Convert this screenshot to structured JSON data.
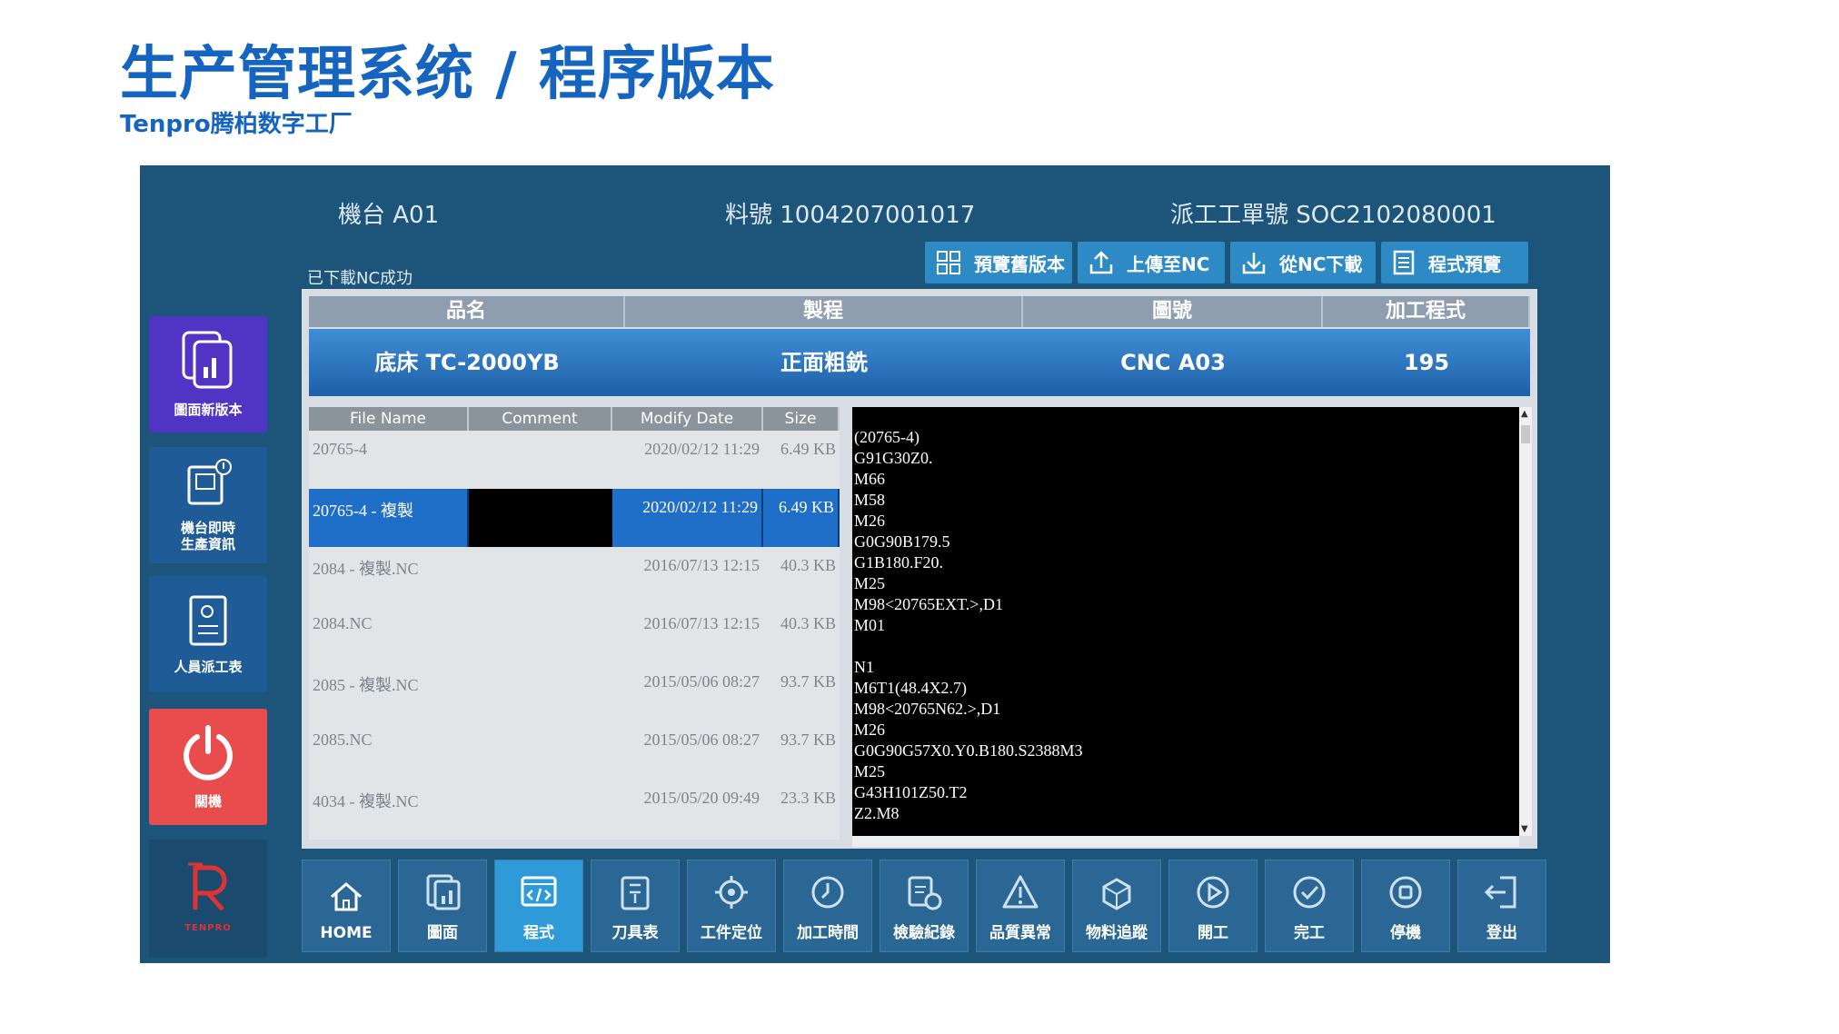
{
  "page": {
    "title": "生产管理系统 / 程序版本",
    "subtitle": "Tenpro腾柏数字工厂"
  },
  "header": {
    "machine": "機台 A01",
    "part_no": "料號 1004207001017",
    "work_order": "派工工單號 SOC2102080001"
  },
  "status": "已下載NC成功",
  "toolbar": {
    "preview_old": "預覽舊版本",
    "upload": "上傳至NC",
    "download": "從NC下載",
    "program_preview": "程式預覽"
  },
  "sidebar": {
    "new_version": "圖面新版本",
    "machine_info_line1": "機台即時",
    "machine_info_line2": "生產資訊",
    "staff_dispatch": "人員派工表",
    "power": "關機",
    "logo_text": "TENPRO"
  },
  "info": {
    "headers": [
      "品名",
      "製程",
      "圖號",
      "加工程式"
    ],
    "values": [
      "底床 TC-2000YB",
      "正面粗銑",
      "CNC A03",
      "195"
    ]
  },
  "file_list": {
    "headers": [
      "File Name",
      "Comment",
      "Modify Date",
      "Size"
    ],
    "rows": [
      {
        "name": "20765-4",
        "comment": "",
        "date": "2020/02/12 11:29",
        "size": "6.49 KB"
      },
      {
        "name": "20765-4 - 複製",
        "comment": "",
        "date": "2020/02/12 11:29",
        "size": "6.49 KB"
      },
      {
        "name": "2084 - 複製.NC",
        "comment": "",
        "date": "2016/07/13 12:15",
        "size": "40.3 KB"
      },
      {
        "name": "2084.NC",
        "comment": "",
        "date": "2016/07/13 12:15",
        "size": "40.3 KB"
      },
      {
        "name": "2085 - 複製.NC",
        "comment": "",
        "date": "2015/05/06 08:27",
        "size": "93.7 KB"
      },
      {
        "name": "2085.NC",
        "comment": "",
        "date": "2015/05/06 08:27",
        "size": "93.7 KB"
      },
      {
        "name": "4034 - 複製.NC",
        "comment": "",
        "date": "2015/05/20 09:49",
        "size": "23.3 KB"
      }
    ],
    "selected_index": 1
  },
  "code": {
    "lines": [
      "(20765-4)",
      "G91G30Z0.",
      "M66",
      "M58",
      "M26",
      "G0G90B179.5",
      "G1B180.F20.",
      "M25",
      "M98<20765EXT.>,D1",
      "M01",
      "",
      "N1",
      "M6T1(48.4X2.7)",
      "M98<20765N62.>,D1",
      "M26",
      "G0G90G57X0.Y0.B180.S2388M3",
      "M25",
      "G43H101Z50.T2",
      "Z2.M8"
    ]
  },
  "bottom_nav": {
    "active_index": 2,
    "items": [
      {
        "label": "HOME",
        "icon": "home-icon"
      },
      {
        "label": "圖面",
        "icon": "drawing-icon"
      },
      {
        "label": "程式",
        "icon": "code-icon"
      },
      {
        "label": "刀具表",
        "icon": "tool-list-icon"
      },
      {
        "label": "工件定位",
        "icon": "target-icon"
      },
      {
        "label": "加工時間",
        "icon": "clock-icon"
      },
      {
        "label": "檢驗紀錄",
        "icon": "inspection-icon"
      },
      {
        "label": "品質異常",
        "icon": "warning-icon"
      },
      {
        "label": "物料追蹤",
        "icon": "material-icon"
      },
      {
        "label": "開工",
        "icon": "play-icon"
      },
      {
        "label": "完工",
        "icon": "check-icon"
      },
      {
        "label": "停機",
        "icon": "stop-icon"
      },
      {
        "label": "登出",
        "icon": "logout-icon"
      }
    ]
  }
}
